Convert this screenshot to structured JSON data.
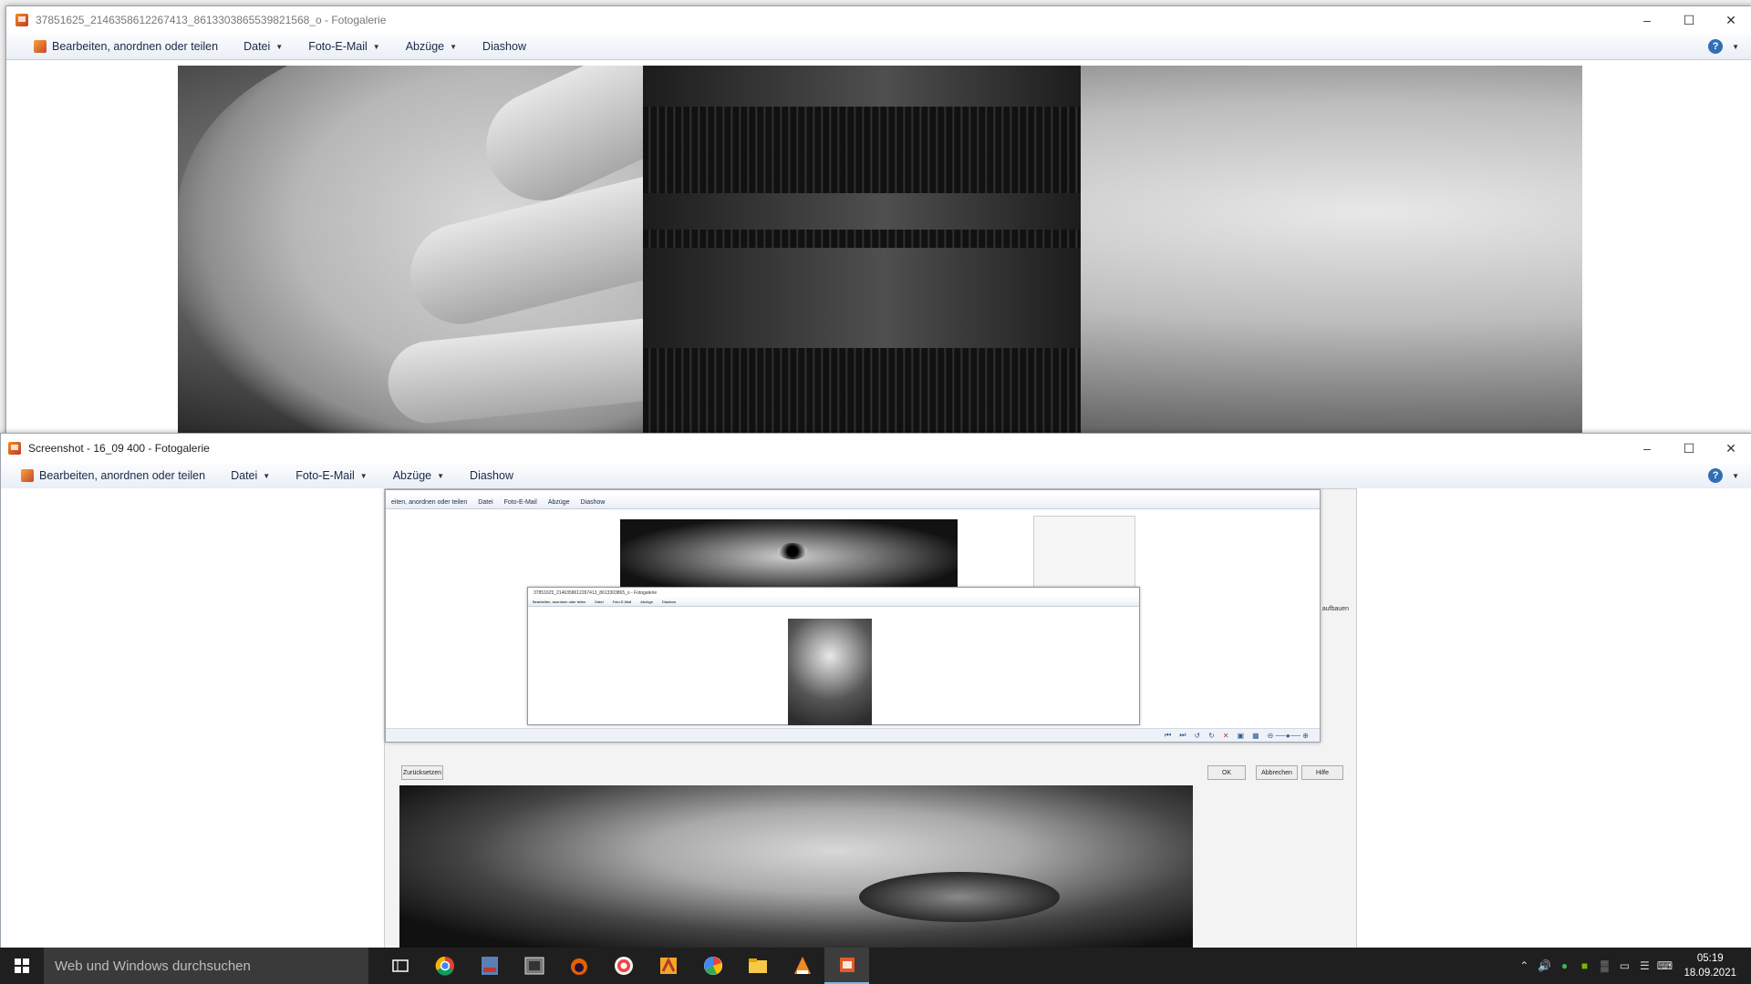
{
  "window1": {
    "title": "37851625_2146358612267413_8613303865539821568_o - Fotogalerie",
    "menu": {
      "edit": "Bearbeiten, anordnen oder teilen",
      "file": "Datei",
      "email": "Foto-E-Mail",
      "prints": "Abzüge",
      "slideshow": "Diashow"
    },
    "help": "?"
  },
  "window2": {
    "title": "Screenshot - 16_09 400 - Fotogalerie",
    "menu": {
      "edit": "Bearbeiten, anordnen oder teilen",
      "file": "Datei",
      "email": "Foto-E-Mail",
      "prints": "Abzüge",
      "slideshow": "Diashow"
    },
    "help": "?"
  },
  "nested": {
    "menu": {
      "edit": "eiten, anordnen oder teilen",
      "file": "Datei",
      "email": "Foto-E-Mail",
      "prints": "Abzüge",
      "slideshow": "Diashow"
    },
    "buttons": {
      "reset": "Zurücksetzen",
      "ok": "OK",
      "cancel": "Abbrechen",
      "help": "Hilfe"
    },
    "side_text": "u aufbauen",
    "inner_window": {
      "title": "37851625_2146358612267413_8613303865_o - Fotogalerie",
      "menu": {
        "edit": "Bearbeiten, anordnen oder teilen",
        "file": "Datei",
        "email": "Foto-E-Mail",
        "prints": "Abzüge",
        "slideshow": "Diashow"
      }
    }
  },
  "taskbar": {
    "search_placeholder": "Web und Windows durchsuchen",
    "time": "05:19",
    "date": "18.09.2021",
    "apps": [
      "task-view",
      "chrome",
      "pdf-viewer",
      "image-viewer",
      "firefox",
      "chrome-alt",
      "app-orange",
      "picasa",
      "file-explorer",
      "vlc",
      "photo-gallery"
    ]
  }
}
